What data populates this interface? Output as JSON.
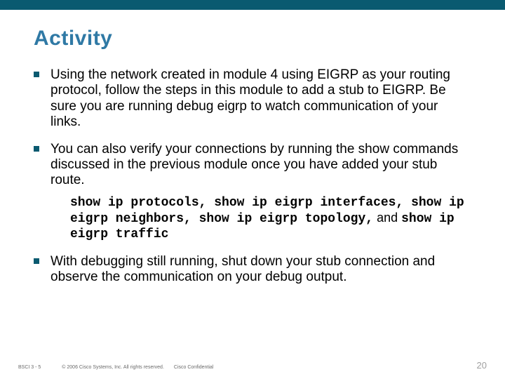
{
  "topbar_color": "#0a5a70",
  "title": "Activity",
  "bullets": [
    {
      "text": "Using the network created in module 4 using EIGRP as your routing protocol, follow the steps in this module to add a stub to EIGRP. Be sure you are running debug eigrp to watch communication of your links."
    },
    {
      "text": "You can also verify your connections by running the show commands discussed in the previous module once you have added your stub route.",
      "sub_mono": "show ip protocols, show ip eigrp interfaces, show ip eigrp neighbors, show ip eigrp topology,",
      "sub_tail_nonmono": " and ",
      "sub_tail_mono": "show ip eigrp traffic"
    },
    {
      "text": "With debugging still running, shut down your stub connection and observe the communication on your debug output."
    }
  ],
  "footer": {
    "label": "BSCI 3 - 5",
    "copyright": "© 2006 Cisco Systems, Inc. All rights reserved.",
    "confidential": "Cisco Confidential",
    "page": "20"
  }
}
